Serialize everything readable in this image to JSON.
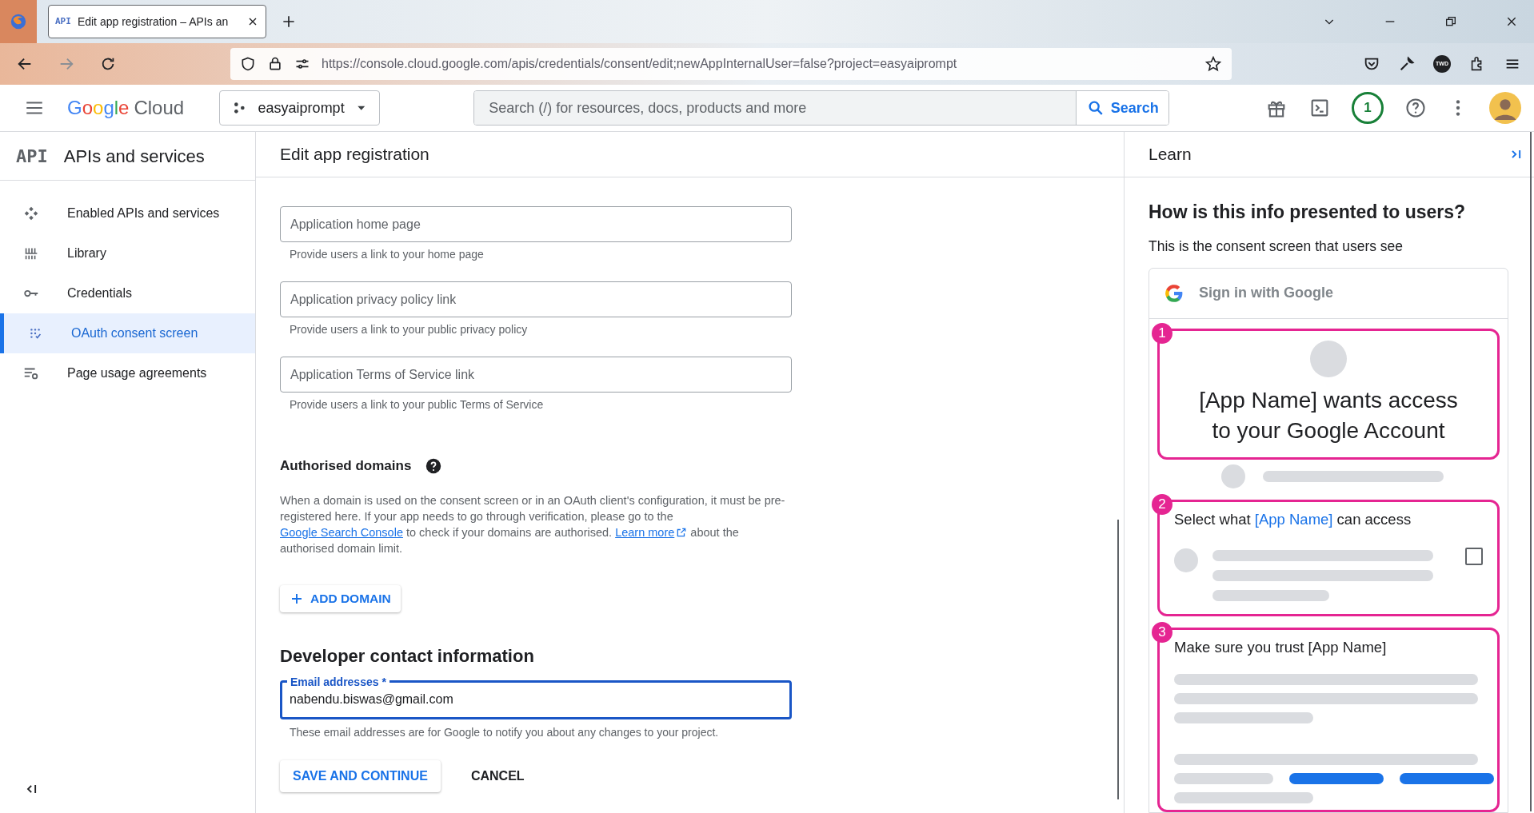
{
  "browser": {
    "tab": {
      "title": "Edit app registration – APIs an",
      "icon_text": "API"
    },
    "url": "https://console.cloud.google.com/apis/credentials/consent/edit;newAppInternalUser=false?project=easyaiprompt",
    "profile_badge": "TWD"
  },
  "header": {
    "logo_word": "Google",
    "logo_product": "Cloud",
    "project": "easyaiprompt",
    "search_placeholder": "Search (/) for resources, docs, products and more",
    "search_button": "Search",
    "notifications": "1"
  },
  "sidebar": {
    "logo_text": "API",
    "title": "APIs and services",
    "items": [
      {
        "label": "Enabled APIs and services",
        "selected": false
      },
      {
        "label": "Library",
        "selected": false
      },
      {
        "label": "Credentials",
        "selected": false
      },
      {
        "label": "OAuth consent screen",
        "selected": true
      },
      {
        "label": "Page usage agreements",
        "selected": false
      }
    ]
  },
  "main": {
    "title": "Edit app registration",
    "fields": [
      {
        "placeholder": "Application home page",
        "helper": "Provide users a link to your home page"
      },
      {
        "placeholder": "Application privacy policy link",
        "helper": "Provide users a link to your public privacy policy"
      },
      {
        "placeholder": "Application Terms of Service link",
        "helper": "Provide users a link to your public Terms of Service"
      }
    ],
    "domains": {
      "heading": "Authorised domains",
      "paragraph": [
        {
          "kind": "text",
          "text": "When a domain is used on the consent screen or in an OAuth client's configuration, it must be pre-registered here. If your app needs to go through verification, please go to the "
        },
        {
          "kind": "link",
          "text": "Google Search Console",
          "external": false
        },
        {
          "kind": "text",
          "text": " to check if your domains are authorised. "
        },
        {
          "kind": "link",
          "text": "Learn more",
          "external": true
        },
        {
          "kind": "text",
          "text": " about the authorised domain limit."
        }
      ],
      "add_button": "ADD DOMAIN"
    },
    "contact": {
      "heading": "Developer contact information",
      "email": {
        "label": "Email addresses *",
        "value": "nabendu.biswas@gmail.com",
        "focused": true
      },
      "helper": "These email addresses are for Google to notify you about any changes to your project."
    },
    "buttons": [
      {
        "label": "SAVE AND CONTINUE",
        "kind": "raised"
      },
      {
        "label": "CANCEL",
        "kind": "text"
      }
    ]
  },
  "learn": {
    "title": "Learn",
    "heading": "How is this info presented to users?",
    "subtext": "This is the consent screen that users see",
    "preview": {
      "signin": "Sign in with Google",
      "steps": [
        {
          "number": "1",
          "kind": "account",
          "text": "[App Name] wants access to your Google Account"
        },
        {
          "number": "2",
          "kind": "scopes",
          "before": "Select what ",
          "highlight": "[App Name]",
          "after": " can access",
          "checked": false
        },
        {
          "number": "3",
          "kind": "trust",
          "text": "Make sure you trust [App Name]"
        }
      ]
    }
  }
}
